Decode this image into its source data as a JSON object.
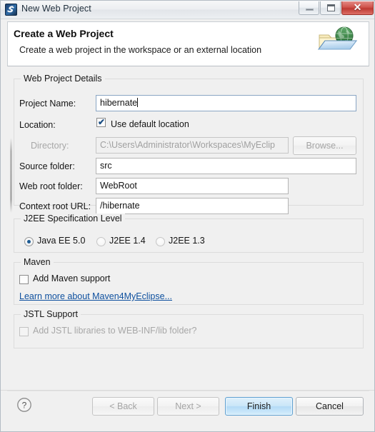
{
  "window": {
    "title": "New Web Project",
    "icon": "myeclipse-app-icon",
    "buttons": {
      "minimize": "minimize-icon",
      "restore": "restore-icon",
      "close": "✕"
    }
  },
  "banner": {
    "title": "Create a Web Project",
    "subtitle": "Create a web project in the workspace or an external location",
    "icon": "web-folder-globe-icon"
  },
  "groups": {
    "web_project_details": {
      "title": "Web Project Details",
      "project_name": {
        "label": "Project Name:",
        "value": "hibernate",
        "placeholder": ""
      },
      "location": {
        "label": "Location:",
        "use_default_label": "Use default location",
        "use_default_checked": true
      },
      "directory": {
        "label": "Directory:",
        "value": "C:\\Users\\Administrator\\Workspaces\\MyEclip",
        "disabled": true,
        "browse_label": "Browse..."
      },
      "source_folder": {
        "label": "Source folder:",
        "value": "src"
      },
      "web_root_folder": {
        "label": "Web root folder:",
        "value": "WebRoot"
      },
      "context_root_url": {
        "label": "Context root URL:",
        "value": "/hibernate"
      }
    },
    "j2ee_spec": {
      "title": "J2EE Specification Level",
      "options": [
        {
          "label": "Java EE 5.0",
          "selected": true
        },
        {
          "label": "J2EE 1.4",
          "selected": false
        },
        {
          "label": "J2EE 1.3",
          "selected": false
        }
      ]
    },
    "maven": {
      "title": "Maven",
      "add_support_label": "Add Maven support",
      "add_support_checked": false,
      "link_label": "Learn more about Maven4MyEclipse..."
    },
    "jstl": {
      "title": "JSTL Support",
      "add_libs_label": "Add JSTL libraries to WEB-INF/lib folder?",
      "add_libs_checked": false,
      "disabled": true
    }
  },
  "footer": {
    "help": "help-icon",
    "back": "< Back",
    "next": "Next >",
    "finish": "Finish",
    "cancel": "Cancel"
  },
  "colors": {
    "accent": "#1d5b93",
    "link": "#0d4f9e",
    "default_button": "#b3daf6",
    "close_button": "#bd3a32",
    "dialog_bg": "#f0f0f0"
  }
}
